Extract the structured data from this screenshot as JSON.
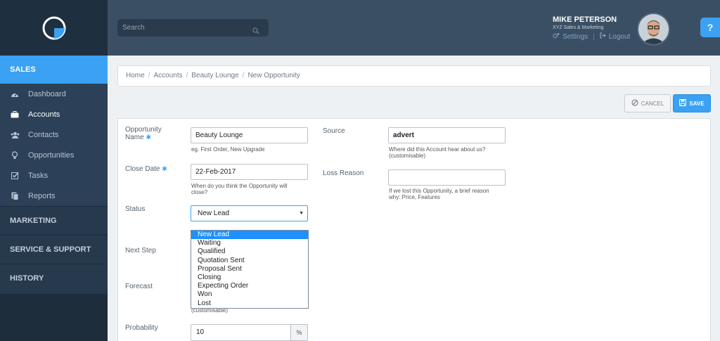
{
  "sidebar": {
    "sales_label": "SALES",
    "items": [
      {
        "label": "Dashboard",
        "icon": "dashboard-icon"
      },
      {
        "label": "Accounts",
        "icon": "briefcase-icon"
      },
      {
        "label": "Contacts",
        "icon": "users-icon"
      },
      {
        "label": "Opportunities",
        "icon": "lightbulb-icon"
      },
      {
        "label": "Tasks",
        "icon": "checkbox-icon"
      },
      {
        "label": "Reports",
        "icon": "reports-icon"
      }
    ],
    "sections": [
      "MARKETING",
      "SERVICE & SUPPORT",
      "HISTORY"
    ]
  },
  "header": {
    "search_placeholder": "Search",
    "user_name": "MIKE PETERSON",
    "user_company": "XYZ Sales & Marketing",
    "settings_label": "Settings",
    "logout_label": "Logout",
    "help_label": "?"
  },
  "breadcrumb": [
    "Home",
    "Accounts",
    "Beauty Lounge",
    "New Opportunity"
  ],
  "actions": {
    "cancel_label": "CANCEL",
    "save_label": "SAVE"
  },
  "form": {
    "opportunity_name": {
      "label_line1": "Opportunity",
      "label_line2": "Name",
      "value": "Beauty Lounge",
      "help": "eg. First Order, New Upgrade"
    },
    "close_date": {
      "label": "Close Date",
      "value": "22-Feb-2017",
      "help_line1": "When do you think the Opportunity will",
      "help_line2": "close?"
    },
    "status": {
      "label": "Status",
      "value": "New Lead",
      "options": [
        "New Lead",
        "Waiting",
        "Qualified",
        "Quotation Sent",
        "Proposal Sent",
        "Closing",
        "Expecting Order",
        "Won",
        "Lost"
      ]
    },
    "next_step": {
      "label": "Next Step"
    },
    "forecast": {
      "label": "Forecast",
      "help": "(customisable)"
    },
    "probability": {
      "label": "Probability",
      "value": "10",
      "unit": "%"
    },
    "source": {
      "label": "Source",
      "value": "advert",
      "help_line1": "Where did this Account hear about us?",
      "help_line2": "(customisable)"
    },
    "loss_reason": {
      "label": "Loss Reason",
      "value": "",
      "help_line1": "If we lost this Opportunity, a brief reason",
      "help_line2": "why: Price, Features"
    }
  },
  "colors": {
    "accent": "#3aa1f3",
    "sidebar": "#27394d",
    "topbar": "#3b4f64"
  }
}
